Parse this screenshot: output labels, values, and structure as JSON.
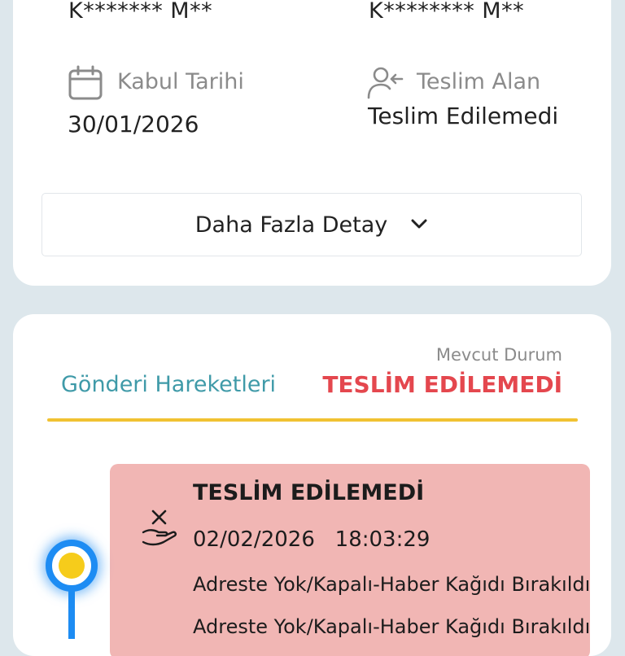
{
  "shipment": {
    "sender_masked": "K******* M**",
    "receiver_masked": "K******** M**",
    "accept_date_label": "Kabul Tarihi",
    "accept_date_value": "30/01/2026",
    "received_by_label": "Teslim Alan",
    "received_by_value": "Teslim Edilemedi",
    "more_details_label": "Daha Fazla Detay"
  },
  "movements": {
    "tab_title": "Gönderi Hareketleri",
    "current_status_caption": "Mevcut Durum",
    "current_status_value": "TESLİM EDİLEMEDİ",
    "events": [
      {
        "title": "TESLİM EDİLEMEDİ",
        "datetime": "02/02/2026   18:03:29",
        "description": "Adreste Yok/Kapalı-Haber Kağıdı Bırakıldı",
        "description_2": "Adreste Yok/Kapalı-Haber Kağıdı Bırakıldı"
      }
    ]
  },
  "icons": {
    "accept_date": "calendar-icon",
    "received_by": "user-receive-icon",
    "more_details": "chevron-down-icon",
    "event": "hand-x-icon"
  },
  "colors": {
    "background": "#dde7ec",
    "tab_title": "#3f9aa8",
    "status": "#e4474e",
    "underline": "#f1c232",
    "event_card": "#f1b6b4",
    "timeline": "#1d8cf3",
    "timeline_dot": "#f6cc1b"
  }
}
